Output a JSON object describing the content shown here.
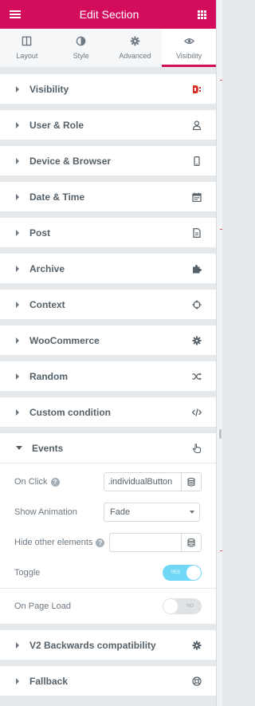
{
  "header": {
    "title": "Edit Section"
  },
  "tabs": [
    {
      "label": "Layout",
      "icon": "layout-icon"
    },
    {
      "label": "Style",
      "icon": "contrast-icon"
    },
    {
      "label": "Advanced",
      "icon": "gear-icon"
    },
    {
      "label": "Visibility",
      "icon": "eye-icon",
      "active": true
    }
  ],
  "sections": [
    {
      "label": "Visibility",
      "icon": "visibility-logo-icon"
    },
    {
      "label": "User & Role",
      "icon": "user-icon"
    },
    {
      "label": "Device & Browser",
      "icon": "mobile-icon"
    },
    {
      "label": "Date & Time",
      "icon": "calendar-icon"
    },
    {
      "label": "Post",
      "icon": "document-icon"
    },
    {
      "label": "Archive",
      "icon": "puzzle-icon"
    },
    {
      "label": "Context",
      "icon": "crosshair-icon"
    },
    {
      "label": "WooCommerce",
      "icon": "gear-icon"
    },
    {
      "label": "Random",
      "icon": "shuffle-icon"
    },
    {
      "label": "Custom condition",
      "icon": "code-icon"
    },
    {
      "label": "Events",
      "icon": "pointer-icon",
      "expanded": true
    },
    {
      "label": "V2 Backwards compatibility",
      "icon": "gear-icon"
    },
    {
      "label": "Fallback",
      "icon": "lifebuoy-icon"
    }
  ],
  "events": {
    "on_click_label": "On Click",
    "on_click_value": ".individualButton",
    "show_animation_label": "Show Animation",
    "show_animation_value": "Fade",
    "hide_other_label": "Hide other elements",
    "hide_other_value": "",
    "toggle_label": "Toggle",
    "toggle_state": "YES",
    "on_page_load_label": "On Page Load",
    "on_page_load_state": "NO"
  },
  "colors": {
    "brand": "#d30c5c",
    "toggle_on": "#71d7f7"
  }
}
